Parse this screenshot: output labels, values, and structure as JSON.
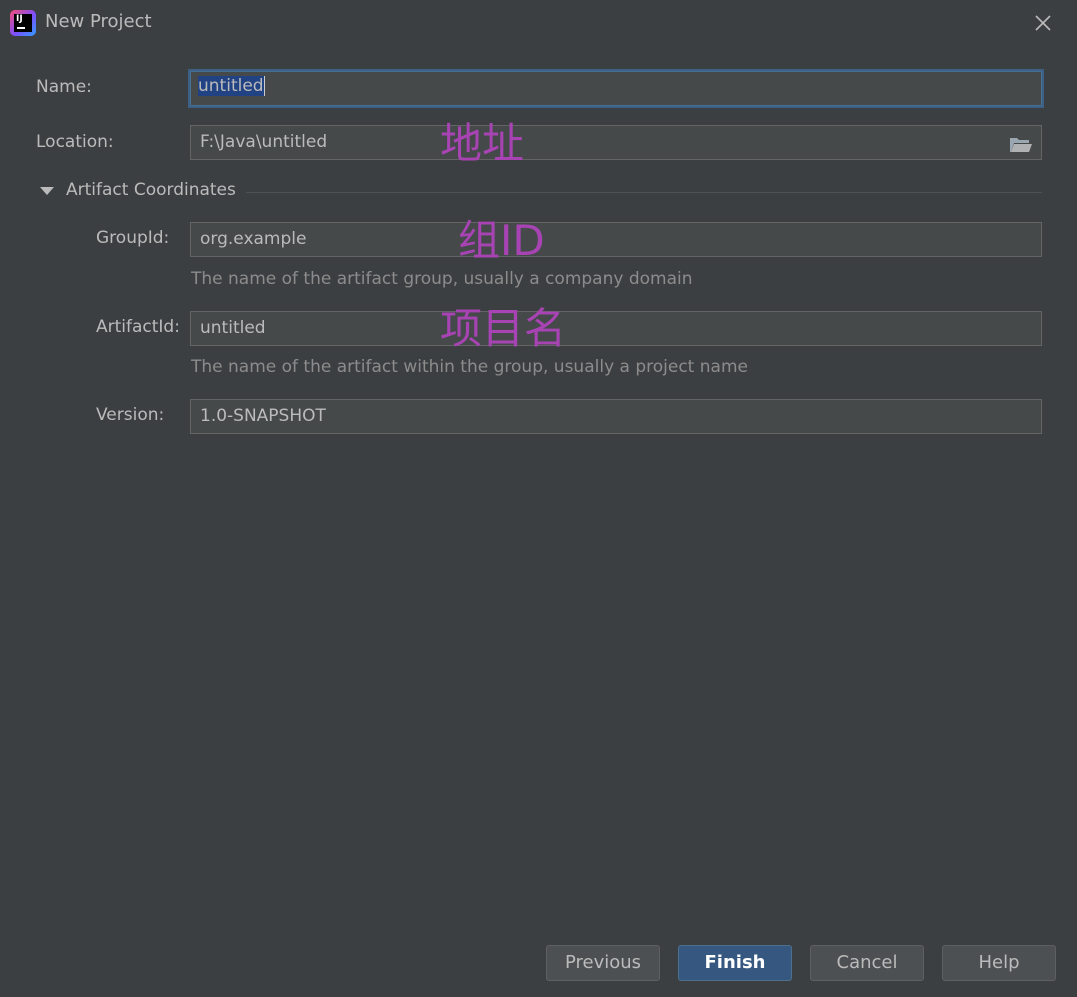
{
  "window": {
    "title": "New Project",
    "app_icon_text": "IJ"
  },
  "form": {
    "name": {
      "label": "Name:",
      "value": "untitled"
    },
    "location": {
      "label": "Location:",
      "value": "F:\\Java\\untitled"
    },
    "artifact_section": {
      "label": "Artifact Coordinates"
    },
    "group_id": {
      "label": "GroupId:",
      "value": "org.example",
      "hint": "The name of the artifact group, usually a company domain"
    },
    "artifact_id": {
      "label": "ArtifactId:",
      "value": "untitled",
      "hint": "The name of the artifact within the group, usually a project name"
    },
    "version": {
      "label": "Version:",
      "value": "1.0-SNAPSHOT"
    }
  },
  "annotations": {
    "location_note": "地址",
    "group_note": "组ID",
    "artifact_note": "项目名"
  },
  "buttons": {
    "previous": "Previous",
    "finish": "Finish",
    "cancel": "Cancel",
    "help": "Help"
  },
  "colors": {
    "background": "#3c3f41",
    "field_background": "#45494a",
    "primary_button": "#365880",
    "annotation": "#a843b4",
    "selection": "#214283"
  }
}
